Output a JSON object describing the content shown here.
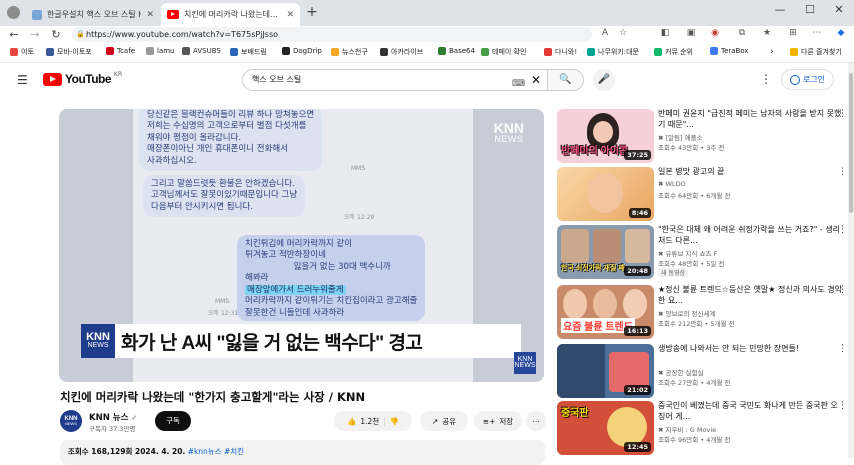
{
  "browser": {
    "tabs": [
      {
        "label": "한글우설치 핵스 오브 스틸 Her..."
      },
      {
        "label": "치킨에 머리카락 나왔는데..."
      }
    ],
    "url": "https://www.youtube.com/watch?v=T675sPjJsso",
    "bookmarks": [
      {
        "label": "이토",
        "color": "#e8453c"
      },
      {
        "label": "모바-이토포",
        "color": "#3b5998"
      },
      {
        "label": "Tcafe",
        "color": "#d0021b"
      },
      {
        "label": "lamu",
        "color": "#999999"
      },
      {
        "label": "AVSUBS",
        "color": "#555555"
      },
      {
        "label": "보배드림",
        "color": "#2a63b8"
      },
      {
        "label": "DogDrip",
        "color": "#222222"
      },
      {
        "label": "뉴스천구",
        "color": "#f5a623"
      },
      {
        "label": "아카라이브",
        "color": "#333333"
      },
      {
        "label": "Base64",
        "color": "#2e7d32"
      },
      {
        "label": "테페이 확인",
        "color": "#43a047"
      },
      {
        "label": "다니와!",
        "color": "#e53935"
      },
      {
        "label": "나무위키:대문",
        "color": "#00a495"
      },
      {
        "label": "커뮤 순위",
        "color": "#0fb86b"
      },
      {
        "label": "TeraBox",
        "color": "#3d7bf7"
      },
      {
        "label": "다른 즐겨찾기",
        "color": "#f0b400"
      }
    ]
  },
  "youtube": {
    "logo_text": "YouTube",
    "region": "KR",
    "search_value": "핵스 오브 스틸",
    "login_label": "로그인"
  },
  "video": {
    "chat_lines": {
      "b1": "당신같은 블랙컨슈머들이 리뷰 하나 망쳐놓으면\n저희는 수십명의 고객으로부터 별점 다섯개를\n채워야 평점이 올라갑니다.\n매장폰이아닌 개인 휴대폰이니 전화해서\n사과하십시오.",
      "b2": "그리고 말씀드렷듯 환불은 안하겠습니다.\n고객님께서도 잘못이있기때문입니다 그냥\n다음부터 안시키시면 됩니다.",
      "b3a": "치킨튀김에 머리카락까지 같이\n튀겨놓고 적반하장이네\n                  잃을거 없는 30대 백수니까\n해봐라",
      "b3_highlight": "매장앞에가서 드러누워줄게",
      "b3b": "머리카락까지 같이튀기는 치킨집이라고 광고해줄\n잘못한건 니들인데 사과하라"
    },
    "mms_label": "MMS",
    "time1": "오후 12:29",
    "time2": "오후 12:31",
    "watermark_top": "KNN",
    "watermark_bottom": "NEWS",
    "caption": "화가 난 A씨 \"잃을 거 없는 백수다\" 경고",
    "title": "치킨에 머리카락 나왔는데 \"한가지 충고할게\"라는 사장 / KNN",
    "channel_name": "KNN 뉴스",
    "channel_check": "✓",
    "subscribers": "구독자 37.3만명",
    "subscribe_label": "구독",
    "likes": "1.2천",
    "share_label": "공유",
    "save_label": "저장",
    "views_line": "조회수 168,129회  2024. 4. 20.",
    "hashtags": "#knn뉴스 #치킨"
  },
  "recommendations": [
    {
      "title": "반페미 권윤지 \"급진적 페미는 남자의 사랑을 받지 못했기 때문\"...",
      "channel": "[알림] 애플소",
      "meta": "조회수 43만회 • 3주 전",
      "duration": "37:25",
      "overlay": "반페미의 아이콘",
      "bg": "#f5d0d8",
      "badge": ""
    },
    {
      "title": "일본 병맛 광고의 끝",
      "channel": "WLDO",
      "meta": "조회수 64만회 • 6개월 전",
      "duration": "8:46",
      "overlay": "",
      "bg": "#f2c07a",
      "badge": ""
    },
    {
      "title": "\"한국은 대체 왜 어려운 쉬정가락을 쓰는 거죠?\" - 생리처드 다른...",
      "channel": "유튜브 지식 쇼츠 F",
      "meta": "조회수 48만회 • 5일 전",
      "duration": "20:48",
      "overlay": "한국 쇠젓가락 재질 째",
      "bg": "#8a9bb0",
      "badge": "새 동영상"
    },
    {
      "title": "★정신 불륜 트렌드☆등산은 옛말★ 정신과 의사도 경악한 요...",
      "channel": "양브로의 정신세계",
      "meta": "조회수 212만회 • 5개월 전",
      "duration": "16:13",
      "overlay": "요즘 불륜 트렌드",
      "bg": "#c98a6a",
      "badge": ""
    },
    {
      "title": "생방송에 나와서는 안 되는 민망한 장면들!",
      "channel": "공장한 실험실",
      "meta": "조회수 27만회 • 4개월 전",
      "duration": "21:02",
      "overlay": "",
      "bg": "#4c6f9a",
      "badge": ""
    },
    {
      "title": "중국인이 베꼈는데 중국 국민도 화나게 만든 중국판 오징어 게...",
      "channel": "지우비 : G Movie",
      "meta": "조회수 96만회 • 4개월 전",
      "duration": "12:45",
      "overlay": "중국판",
      "bg": "#d2503a",
      "badge": ""
    }
  ]
}
